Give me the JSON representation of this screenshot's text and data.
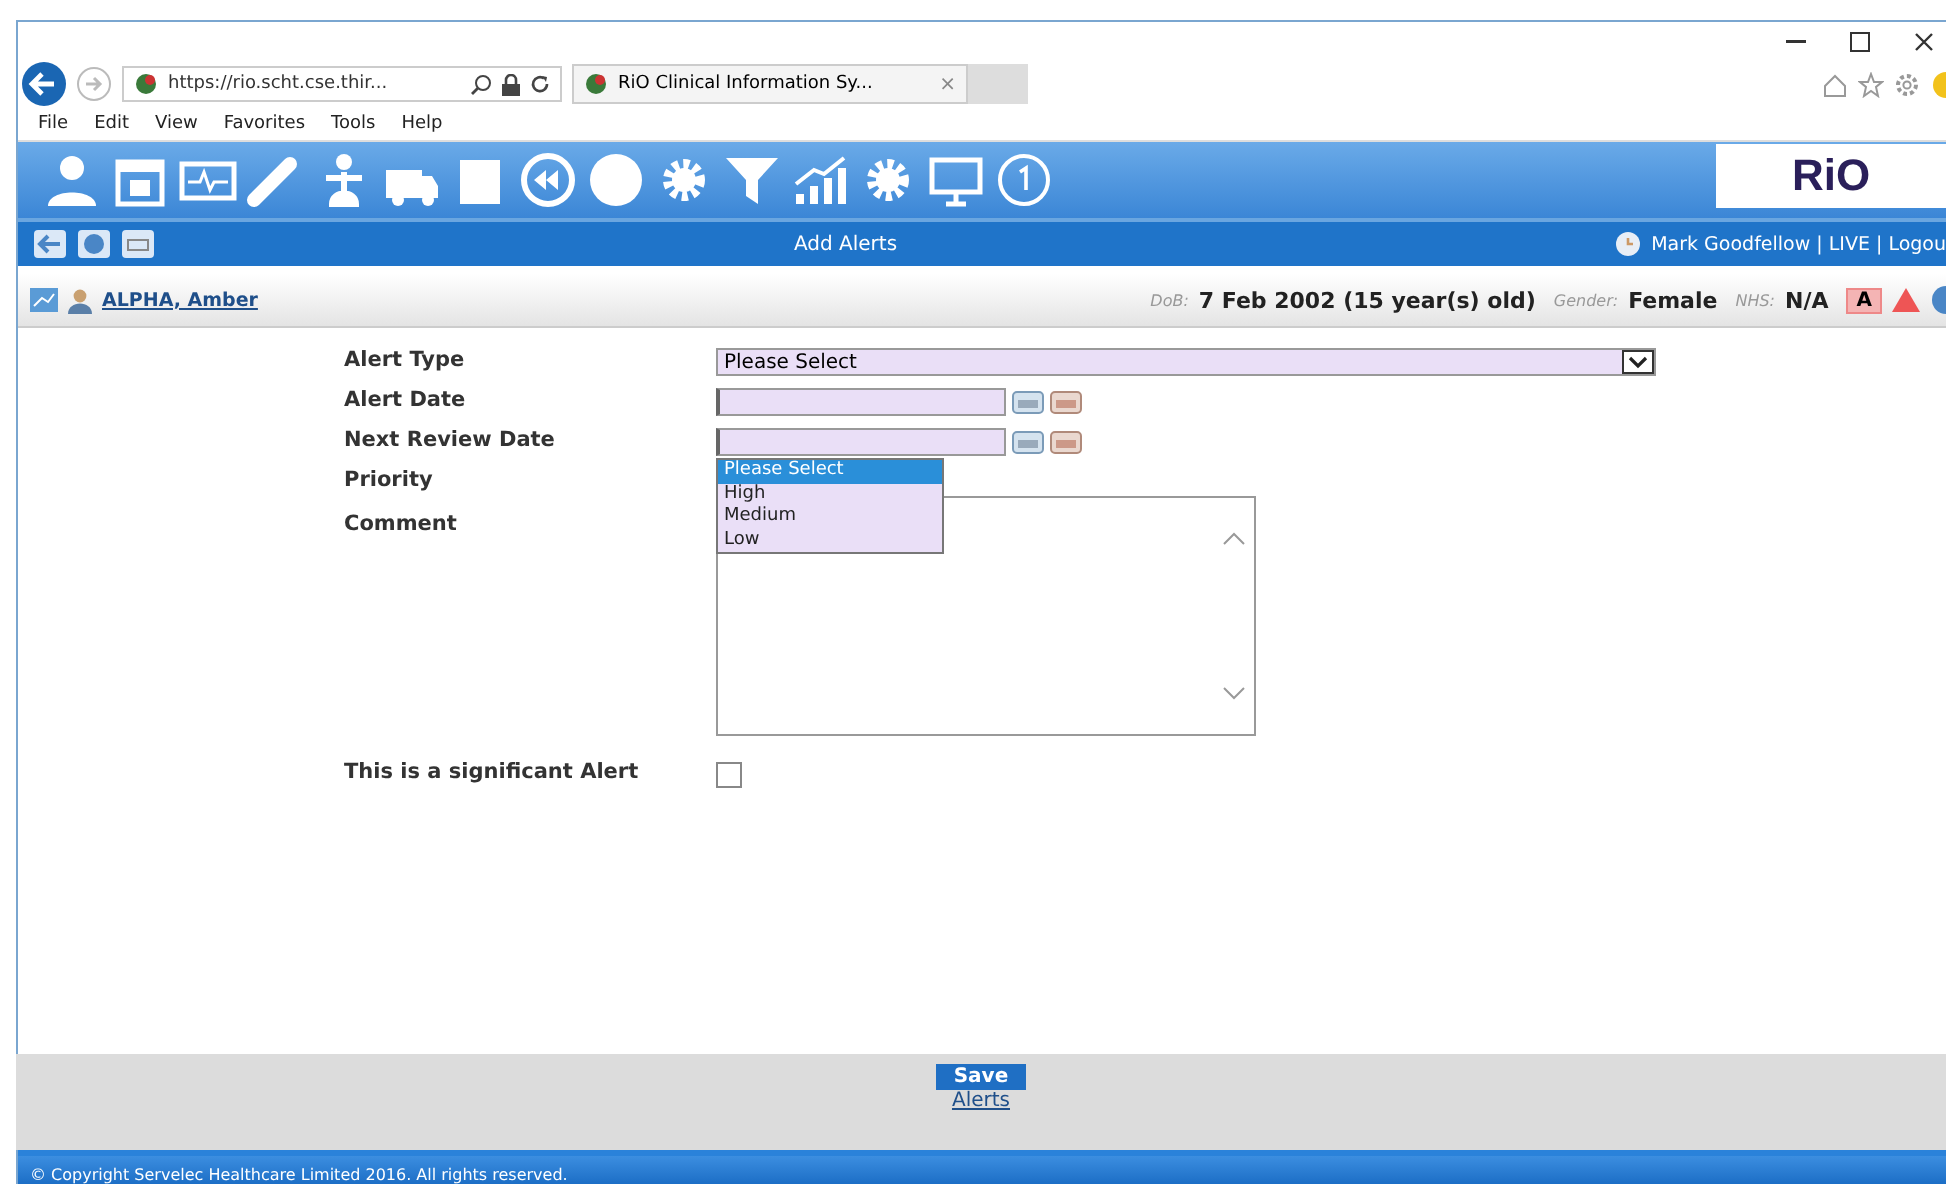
{
  "browser": {
    "address": "https://rio.scht.cse.thir...",
    "tab": {
      "label": "RiO Clinical Information Sy...",
      "close": "×"
    },
    "menu": [
      "File",
      "Edit",
      "View",
      "Favorites",
      "Tools",
      "Help"
    ]
  },
  "app": {
    "logo": "RiO",
    "page_title": "Add Alerts",
    "user": "Mark Goodfellow | LIVE | Logou"
  },
  "patient": {
    "name": "ALPHA, Amber",
    "dob_label": "DoB:",
    "dob": "7 Feb 2002 (15 year(s) old)",
    "gender_label": "Gender:",
    "gender": "Female",
    "nhs_label": "NHS:",
    "nhs": "N/A",
    "alert_badge": "A"
  },
  "form": {
    "fields": [
      {
        "kind": "select",
        "label": "Alert Type",
        "value": "Please Select"
      },
      {
        "kind": "date",
        "label": "Alert Date"
      },
      {
        "kind": "date",
        "label": "Next Review Date"
      },
      {
        "kind": "listbox",
        "label": "Priority",
        "options": [
          {
            "label": "Please Select",
            "selected": true
          },
          {
            "label": "High",
            "selected": false
          },
          {
            "label": "Medium",
            "selected": false
          },
          {
            "label": "Low",
            "selected": false
          }
        ]
      },
      {
        "kind": "textarea",
        "label": "Comment"
      },
      {
        "kind": "checkbox",
        "label": "This is a significant Alert",
        "checked": false
      }
    ]
  },
  "footer": {
    "save": "Save",
    "link": "Alerts",
    "copyright": "© Copyright Servelec Healthcare Limited 2016. All rights reserved."
  }
}
